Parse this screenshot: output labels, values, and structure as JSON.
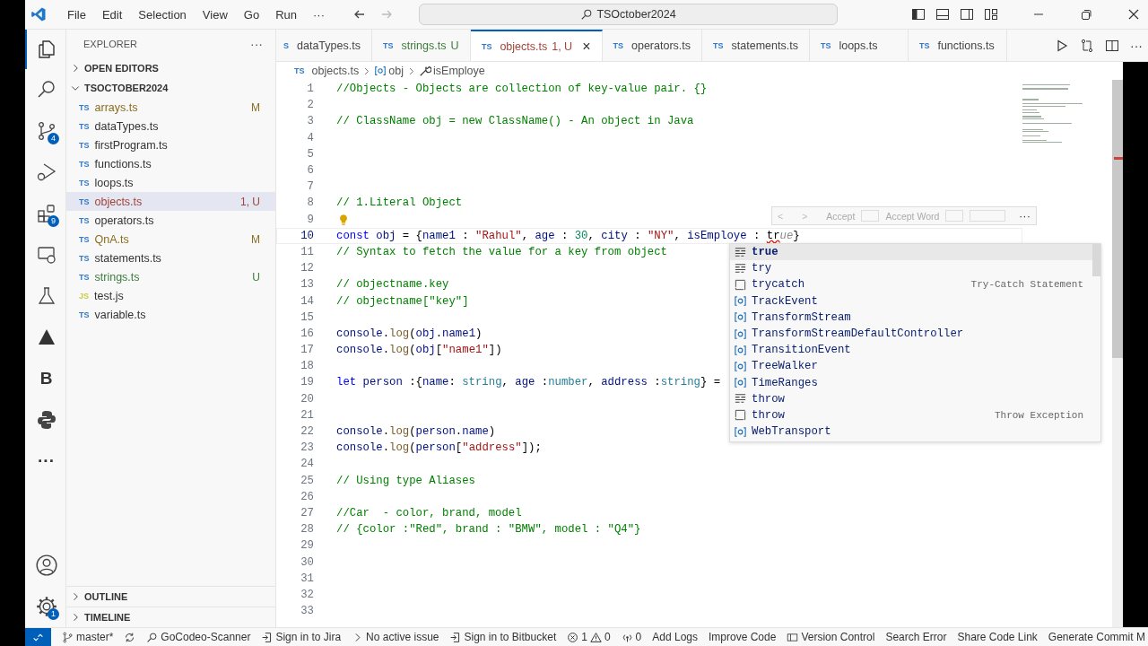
{
  "title_bar": {
    "menus": [
      "File",
      "Edit",
      "Selection",
      "View",
      "Go",
      "Run",
      "···"
    ],
    "search": {
      "value": "TSOctober2024"
    }
  },
  "activity_bar": {
    "items": [
      {
        "kind": "files",
        "selected": true
      },
      {
        "kind": "search",
        "selected": false
      },
      {
        "kind": "source-control",
        "badge": "4",
        "selected": false
      },
      {
        "kind": "run-debug",
        "selected": false
      },
      {
        "kind": "extensions",
        "badge": "9",
        "selected": false
      },
      {
        "kind": "remote",
        "selected": false
      },
      {
        "kind": "flask",
        "selected": false
      },
      {
        "kind": "triangle",
        "selected": false
      },
      {
        "kind": "letter",
        "glyph": "B",
        "selected": false
      },
      {
        "kind": "python",
        "selected": false
      },
      {
        "kind": "more",
        "glyph": "···",
        "selected": false
      }
    ],
    "bottom": [
      {
        "kind": "account"
      },
      {
        "kind": "gear",
        "badge": "1"
      }
    ]
  },
  "sidebar": {
    "title": "EXPLORER",
    "more": "···",
    "sections": [
      {
        "label": "OPEN EDITORS",
        "expanded": false
      },
      {
        "label": "TSOCTOBER2024",
        "expanded": true
      }
    ],
    "files": [
      {
        "icon": "TS",
        "name": "arrays.ts",
        "status": "M",
        "color": "#8a6d1f",
        "selected": false
      },
      {
        "icon": "TS",
        "name": "dataTypes.ts",
        "selected": false
      },
      {
        "icon": "TS",
        "name": "firstProgram.ts",
        "selected": false
      },
      {
        "icon": "TS",
        "name": "functions.ts",
        "selected": false
      },
      {
        "icon": "TS",
        "name": "loops.ts",
        "selected": false
      },
      {
        "icon": "TS",
        "name": "objects.ts",
        "status": "1, U",
        "color": "#a1433a",
        "selected": true
      },
      {
        "icon": "TS",
        "name": "operators.ts",
        "selected": false
      },
      {
        "icon": "TS",
        "name": "QnA.ts",
        "status": "M",
        "color": "#8a6d1f",
        "selected": false
      },
      {
        "icon": "TS",
        "name": "statements.ts",
        "selected": false
      },
      {
        "icon": "TS",
        "name": "strings.ts",
        "status": "U",
        "color": "#3c7d3a",
        "selected": false
      },
      {
        "icon": "JS",
        "name": "test.js",
        "selected": false
      },
      {
        "icon": "TS",
        "name": "variable.ts",
        "selected": false
      }
    ],
    "bottom_sections": [
      {
        "label": "OUTLINE",
        "expanded": false
      },
      {
        "label": "TIMELINE",
        "expanded": false
      }
    ]
  },
  "tabs": [
    {
      "icon": "S",
      "label": "dataTypes.ts",
      "selected": false
    },
    {
      "icon": "TS",
      "label": "strings.ts",
      "status": "U",
      "color": "#3c7d3a",
      "selected": false
    },
    {
      "icon": "TS",
      "label": "objects.ts",
      "status": "1, U",
      "color": "#a1433a",
      "selected": true,
      "close": "×"
    },
    {
      "icon": "TS",
      "label": "operators.ts",
      "selected": false
    },
    {
      "icon": "TS",
      "label": "statements.ts",
      "selected": false
    },
    {
      "icon": "TS",
      "label": "loops.ts",
      "selected": false
    },
    {
      "icon": "TS",
      "label": "functions.ts",
      "selected": false
    }
  ],
  "tab_actions": {
    "more": "···"
  },
  "breadcrumb": [
    {
      "kind": "file",
      "icon": "TS",
      "label": "objects.ts"
    },
    {
      "kind": "variable",
      "label": "obj"
    },
    {
      "kind": "property",
      "label": "isEmploye"
    }
  ],
  "editor": {
    "lines": [
      {
        "number": "1",
        "current": false,
        "tokens": [
          {
            "kind": "c",
            "text": "//Objects - Objects are collection of key-value pair. {}"
          }
        ]
      },
      {
        "number": "2",
        "current": false
      },
      {
        "number": "3",
        "current": false,
        "tokens": [
          {
            "kind": "c",
            "text": "// ClassName obj = new ClassName() - An object in Java"
          }
        ]
      },
      {
        "number": "4",
        "current": false
      },
      {
        "number": "5",
        "current": false
      },
      {
        "number": "6",
        "current": false
      },
      {
        "number": "7",
        "current": false
      },
      {
        "number": "8",
        "current": false,
        "tokens": [
          {
            "kind": "c",
            "text": "// 1.Literal Object"
          }
        ]
      },
      {
        "number": "9",
        "current": false,
        "lightbulb": true
      },
      {
        "number": "10",
        "current": true,
        "tokens": [
          {
            "kind": "k",
            "text": "const"
          },
          {
            "kind": "v",
            "text": " obj"
          },
          {
            "kind": "p",
            "text": " = {"
          },
          {
            "kind": "v",
            "text": "name1"
          },
          {
            "kind": "p",
            "text": " : "
          },
          {
            "kind": "s",
            "text": "\"Rahul\""
          },
          {
            "kind": "p",
            "text": ", "
          },
          {
            "kind": "v",
            "text": "age"
          },
          {
            "kind": "p",
            "text": " : "
          },
          {
            "kind": "n",
            "text": "30"
          },
          {
            "kind": "p",
            "text": ", "
          },
          {
            "kind": "v",
            "text": "city"
          },
          {
            "kind": "p",
            "text": " : "
          },
          {
            "kind": "s",
            "text": "\"NY\""
          },
          {
            "kind": "p",
            "text": ", "
          },
          {
            "kind": "v",
            "text": "isEmploye"
          },
          {
            "kind": "p",
            "text": " : "
          },
          {
            "kind": "e",
            "text": "tr"
          },
          {
            "kind": "g",
            "text": "ue"
          },
          {
            "kind": "p",
            "text": "}"
          }
        ]
      },
      {
        "number": "11",
        "current": false,
        "tokens": [
          {
            "kind": "c",
            "text": "// Syntax to fetch the value for a key from object"
          }
        ]
      },
      {
        "number": "12",
        "current": false
      },
      {
        "number": "13",
        "current": false,
        "tokens": [
          {
            "kind": "c",
            "text": "// objectname.key"
          }
        ]
      },
      {
        "number": "14",
        "current": false,
        "tokens": [
          {
            "kind": "c",
            "text": "// objectname[\"key\"]"
          }
        ]
      },
      {
        "number": "15",
        "current": false
      },
      {
        "number": "16",
        "current": false,
        "tokens": [
          {
            "kind": "v",
            "text": "console"
          },
          {
            "kind": "p",
            "text": "."
          },
          {
            "kind": "f",
            "text": "log"
          },
          {
            "kind": "p",
            "text": "("
          },
          {
            "kind": "v",
            "text": "obj"
          },
          {
            "kind": "p",
            "text": "."
          },
          {
            "kind": "v",
            "text": "name1"
          },
          {
            "kind": "p",
            "text": ")"
          }
        ]
      },
      {
        "number": "17",
        "current": false,
        "tokens": [
          {
            "kind": "v",
            "text": "console"
          },
          {
            "kind": "p",
            "text": "."
          },
          {
            "kind": "f",
            "text": "log"
          },
          {
            "kind": "p",
            "text": "("
          },
          {
            "kind": "v",
            "text": "obj"
          },
          {
            "kind": "p",
            "text": "["
          },
          {
            "kind": "s",
            "text": "\"name1\""
          },
          {
            "kind": "p",
            "text": "])"
          }
        ]
      },
      {
        "number": "18",
        "current": false
      },
      {
        "number": "19",
        "current": false,
        "tokens": [
          {
            "kind": "k",
            "text": "let"
          },
          {
            "kind": "v",
            "text": " person"
          },
          {
            "kind": "p",
            "text": " :{"
          },
          {
            "kind": "v",
            "text": "name"
          },
          {
            "kind": "p",
            "text": ": "
          },
          {
            "kind": "t",
            "text": "string"
          },
          {
            "kind": "p",
            "text": ", "
          },
          {
            "kind": "v",
            "text": "age"
          },
          {
            "kind": "p",
            "text": " :"
          },
          {
            "kind": "t",
            "text": "number"
          },
          {
            "kind": "p",
            "text": ", "
          },
          {
            "kind": "v",
            "text": "address"
          },
          {
            "kind": "p",
            "text": " :"
          },
          {
            "kind": "t",
            "text": "string"
          },
          {
            "kind": "p",
            "text": "} ="
          }
        ]
      },
      {
        "number": "20",
        "current": false
      },
      {
        "number": "21",
        "current": false
      },
      {
        "number": "22",
        "current": false,
        "tokens": [
          {
            "kind": "v",
            "text": "console"
          },
          {
            "kind": "p",
            "text": "."
          },
          {
            "kind": "f",
            "text": "log"
          },
          {
            "kind": "p",
            "text": "("
          },
          {
            "kind": "v",
            "text": "person"
          },
          {
            "kind": "p",
            "text": "."
          },
          {
            "kind": "v",
            "text": "name"
          },
          {
            "kind": "p",
            "text": ")"
          }
        ]
      },
      {
        "number": "23",
        "current": false,
        "tokens": [
          {
            "kind": "v",
            "text": "console"
          },
          {
            "kind": "p",
            "text": "."
          },
          {
            "kind": "f",
            "text": "log"
          },
          {
            "kind": "p",
            "text": "("
          },
          {
            "kind": "v",
            "text": "person"
          },
          {
            "kind": "p",
            "text": "["
          },
          {
            "kind": "s",
            "text": "\"address\""
          },
          {
            "kind": "p",
            "text": "]);"
          }
        ]
      },
      {
        "number": "24",
        "current": false
      },
      {
        "number": "25",
        "current": false,
        "tokens": [
          {
            "kind": "c",
            "text": "// Using type Aliases"
          }
        ]
      },
      {
        "number": "26",
        "current": false
      },
      {
        "number": "27",
        "current": false,
        "tokens": [
          {
            "kind": "c",
            "text": "//Car  - color, brand, model"
          }
        ]
      },
      {
        "number": "28",
        "current": false,
        "tokens": [
          {
            "kind": "c",
            "text": "// {color :\"Red\", brand : \"BMW\", model : \"Q4\"}"
          }
        ]
      },
      {
        "number": "29",
        "current": false
      },
      {
        "number": "30",
        "current": false
      },
      {
        "number": "31",
        "current": false
      },
      {
        "number": "32",
        "current": false
      },
      {
        "number": "33",
        "current": false
      }
    ]
  },
  "inline_toolbar": {
    "prev": "<",
    "next": ">",
    "accept": "Accept",
    "accept_word": "Accept Word",
    "more": "···"
  },
  "suggestions": [
    {
      "kind": "keyword",
      "label": "true",
      "selected": true
    },
    {
      "kind": "keyword",
      "label": "try",
      "selected": false
    },
    {
      "kind": "snippet",
      "label": "trycatch",
      "detail": "Try-Catch Statement",
      "selected": false
    },
    {
      "kind": "variable",
      "label": "TrackEvent",
      "selected": false
    },
    {
      "kind": "variable",
      "label": "TransformStream",
      "selected": false
    },
    {
      "kind": "variable",
      "label": "TransformStreamDefaultController",
      "selected": false
    },
    {
      "kind": "variable",
      "label": "TransitionEvent",
      "selected": false
    },
    {
      "kind": "variable",
      "label": "TreeWalker",
      "selected": false
    },
    {
      "kind": "variable",
      "label": "TimeRanges",
      "selected": false
    },
    {
      "kind": "keyword",
      "label": "throw",
      "selected": false
    },
    {
      "kind": "snippet",
      "label": "throw",
      "detail": "Throw Exception",
      "selected": false
    },
    {
      "kind": "variable",
      "label": "WebTransport",
      "selected": false
    }
  ],
  "status_bar": [
    {
      "kind": "branch",
      "text": "master*"
    },
    {
      "kind": "sync"
    },
    {
      "kind": "search",
      "text": "GoCodeo-Scanner"
    },
    {
      "kind": "signin",
      "text": "Sign in to Jira"
    },
    {
      "kind": "chevron",
      "text": "No active issue"
    },
    {
      "kind": "signin",
      "text": "Sign in to Bitbucket"
    },
    {
      "kind": "problems",
      "errors": "1",
      "warnings": "0"
    },
    {
      "kind": "ports",
      "text": "0"
    },
    {
      "kind": "plain",
      "text": "Add Logs"
    },
    {
      "kind": "plain",
      "text": "Improve Code"
    },
    {
      "kind": "panel",
      "text": "Version Control"
    },
    {
      "kind": "plain",
      "text": "Search Error"
    },
    {
      "kind": "plain",
      "text": "Share Code Link"
    },
    {
      "kind": "plain",
      "text": "Generate Commit M"
    }
  ]
}
